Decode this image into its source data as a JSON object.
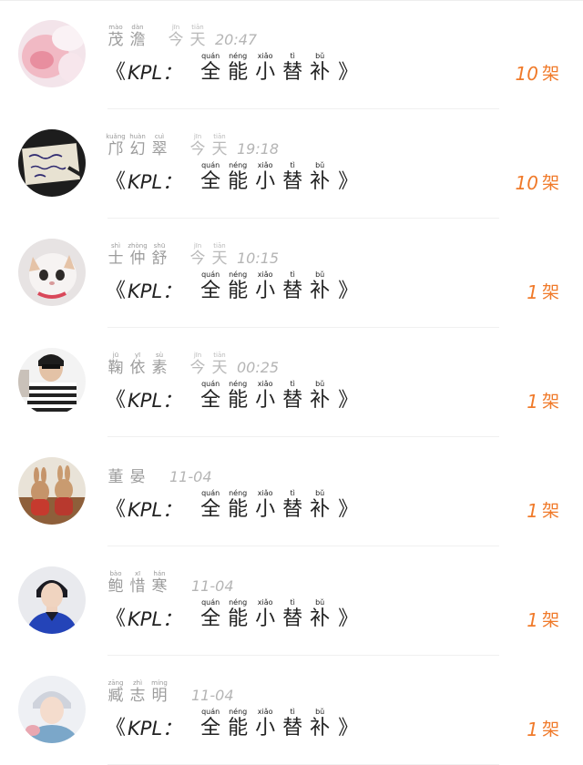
{
  "colors": {
    "accent": "#f07a2a",
    "name_text": "#9c9c9c",
    "time_text": "#b5b5b5",
    "title_text": "#222222",
    "divider": "#f0f0f0"
  },
  "items": [
    {
      "name": [
        {
          "py": "mào",
          "hz": "茂"
        },
        {
          "py": "dàn",
          "hz": "澹"
        }
      ],
      "date_chars": [
        {
          "py": "jīn",
          "hz": "今"
        },
        {
          "py": "tiān",
          "hz": "天"
        }
      ],
      "time": "20:47",
      "title": {
        "open": "《",
        "prefix": "KPL：",
        "chars": [
          {
            "py": "quán",
            "hz": "全"
          },
          {
            "py": "néng",
            "hz": "能"
          },
          {
            "py": "xiǎo",
            "hz": "小"
          },
          {
            "py": "tì",
            "hz": "替"
          },
          {
            "py": "bǔ",
            "hz": "补"
          }
        ],
        "close": "》"
      },
      "count": "10",
      "unit": "架",
      "avatar": "avatar-baby"
    },
    {
      "name": [
        {
          "py": "kuǎng",
          "hz": "邝"
        },
        {
          "py": "huàn",
          "hz": "幻"
        },
        {
          "py": "cuì",
          "hz": "翠"
        }
      ],
      "date_chars": [
        {
          "py": "jīn",
          "hz": "今"
        },
        {
          "py": "tiān",
          "hz": "天"
        }
      ],
      "time": "19:18",
      "title": {
        "open": "《",
        "prefix": "KPL：",
        "chars": [
          {
            "py": "quán",
            "hz": "全"
          },
          {
            "py": "néng",
            "hz": "能"
          },
          {
            "py": "xiǎo",
            "hz": "小"
          },
          {
            "py": "tì",
            "hz": "替"
          },
          {
            "py": "bǔ",
            "hz": "补"
          }
        ],
        "close": "》"
      },
      "count": "10",
      "unit": "架",
      "avatar": "avatar-handwriting"
    },
    {
      "name": [
        {
          "py": "shì",
          "hz": "士"
        },
        {
          "py": "zhòng",
          "hz": "仲"
        },
        {
          "py": "shū",
          "hz": "舒"
        }
      ],
      "date_chars": [
        {
          "py": "jīn",
          "hz": "今"
        },
        {
          "py": "tiān",
          "hz": "天"
        }
      ],
      "time": "10:15",
      "title": {
        "open": "《",
        "prefix": "KPL：",
        "chars": [
          {
            "py": "quán",
            "hz": "全"
          },
          {
            "py": "néng",
            "hz": "能"
          },
          {
            "py": "xiǎo",
            "hz": "小"
          },
          {
            "py": "tì",
            "hz": "替"
          },
          {
            "py": "bǔ",
            "hz": "补"
          }
        ],
        "close": "》"
      },
      "count": "1",
      "unit": "架",
      "avatar": "avatar-cat"
    },
    {
      "name": [
        {
          "py": "jū",
          "hz": "鞠"
        },
        {
          "py": "yī",
          "hz": "依"
        },
        {
          "py": "sù",
          "hz": "素"
        }
      ],
      "date_chars": [
        {
          "py": "jīn",
          "hz": "今"
        },
        {
          "py": "tiān",
          "hz": "天"
        }
      ],
      "time": "00:25",
      "title": {
        "open": "《",
        "prefix": "KPL：",
        "chars": [
          {
            "py": "quán",
            "hz": "全"
          },
          {
            "py": "néng",
            "hz": "能"
          },
          {
            "py": "xiǎo",
            "hz": "小"
          },
          {
            "py": "tì",
            "hz": "替"
          },
          {
            "py": "bǔ",
            "hz": "补"
          }
        ],
        "close": "》"
      },
      "count": "1",
      "unit": "架",
      "avatar": "avatar-stripes"
    },
    {
      "name": [
        {
          "py": "",
          "hz": "董"
        },
        {
          "py": "",
          "hz": "晏"
        }
      ],
      "date_chars": [],
      "time": "11-04",
      "title": {
        "open": "《",
        "prefix": "KPL：",
        "chars": [
          {
            "py": "quán",
            "hz": "全"
          },
          {
            "py": "néng",
            "hz": "能"
          },
          {
            "py": "xiǎo",
            "hz": "小"
          },
          {
            "py": "tì",
            "hz": "替"
          },
          {
            "py": "bǔ",
            "hz": "补"
          }
        ],
        "close": "》"
      },
      "count": "1",
      "unit": "架",
      "avatar": "avatar-bunnies"
    },
    {
      "name": [
        {
          "py": "bào",
          "hz": "鲍"
        },
        {
          "py": "xī",
          "hz": "惜"
        },
        {
          "py": "hán",
          "hz": "寒"
        }
      ],
      "date_chars": [],
      "time": "11-04",
      "title": {
        "open": "《",
        "prefix": "KPL：",
        "chars": [
          {
            "py": "quán",
            "hz": "全"
          },
          {
            "py": "néng",
            "hz": "能"
          },
          {
            "py": "xiǎo",
            "hz": "小"
          },
          {
            "py": "tì",
            "hz": "替"
          },
          {
            "py": "bǔ",
            "hz": "补"
          }
        ],
        "close": "》"
      },
      "count": "1",
      "unit": "架",
      "avatar": "avatar-boy-blue"
    },
    {
      "name": [
        {
          "py": "zāng",
          "hz": "臧"
        },
        {
          "py": "zhì",
          "hz": "志"
        },
        {
          "py": "míng",
          "hz": "明"
        }
      ],
      "date_chars": [],
      "time": "11-04",
      "title": {
        "open": "《",
        "prefix": "KPL：",
        "chars": [
          {
            "py": "quán",
            "hz": "全"
          },
          {
            "py": "néng",
            "hz": "能"
          },
          {
            "py": "xiǎo",
            "hz": "小"
          },
          {
            "py": "tì",
            "hz": "替"
          },
          {
            "py": "bǔ",
            "hz": "补"
          }
        ],
        "close": "》"
      },
      "count": "1",
      "unit": "架",
      "avatar": "avatar-boy-light"
    }
  ]
}
